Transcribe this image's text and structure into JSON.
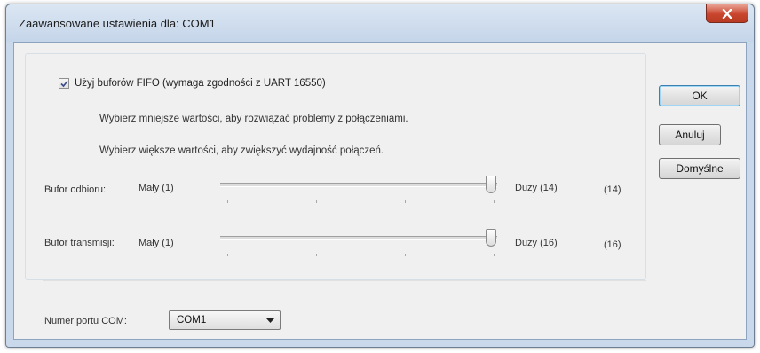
{
  "window": {
    "title": "Zaawansowane ustawienia dla: COM1"
  },
  "fifo": {
    "label": "Użyj buforów FIFO (wymaga zgodności z UART 16550)",
    "checked": true
  },
  "hints": {
    "lower": "Wybierz mniejsze wartości, aby rozwiązać problemy z połączeniami.",
    "higher": "Wybierz większe wartości, aby zwiększyć wydajność połączeń."
  },
  "receive_buffer": {
    "label": "Bufor odbioru:",
    "min_label": "Mały (1)",
    "max_label": "Duży (14)",
    "value_display": "(14)",
    "value": 14,
    "max": 14
  },
  "transmit_buffer": {
    "label": "Bufor transmisji:",
    "min_label": "Mały (1)",
    "max_label": "Duży (16)",
    "value_display": "(16)",
    "value": 16,
    "max": 16
  },
  "port": {
    "label": "Numer portu COM:",
    "selected": "COM1"
  },
  "buttons": {
    "ok": "OK",
    "cancel": "Anuluj",
    "defaults": "Domyślne"
  },
  "colors": {
    "close_button": "#c9452e",
    "title_bar": "#c5d5e9",
    "dialog_face": "#f0f0f0"
  }
}
